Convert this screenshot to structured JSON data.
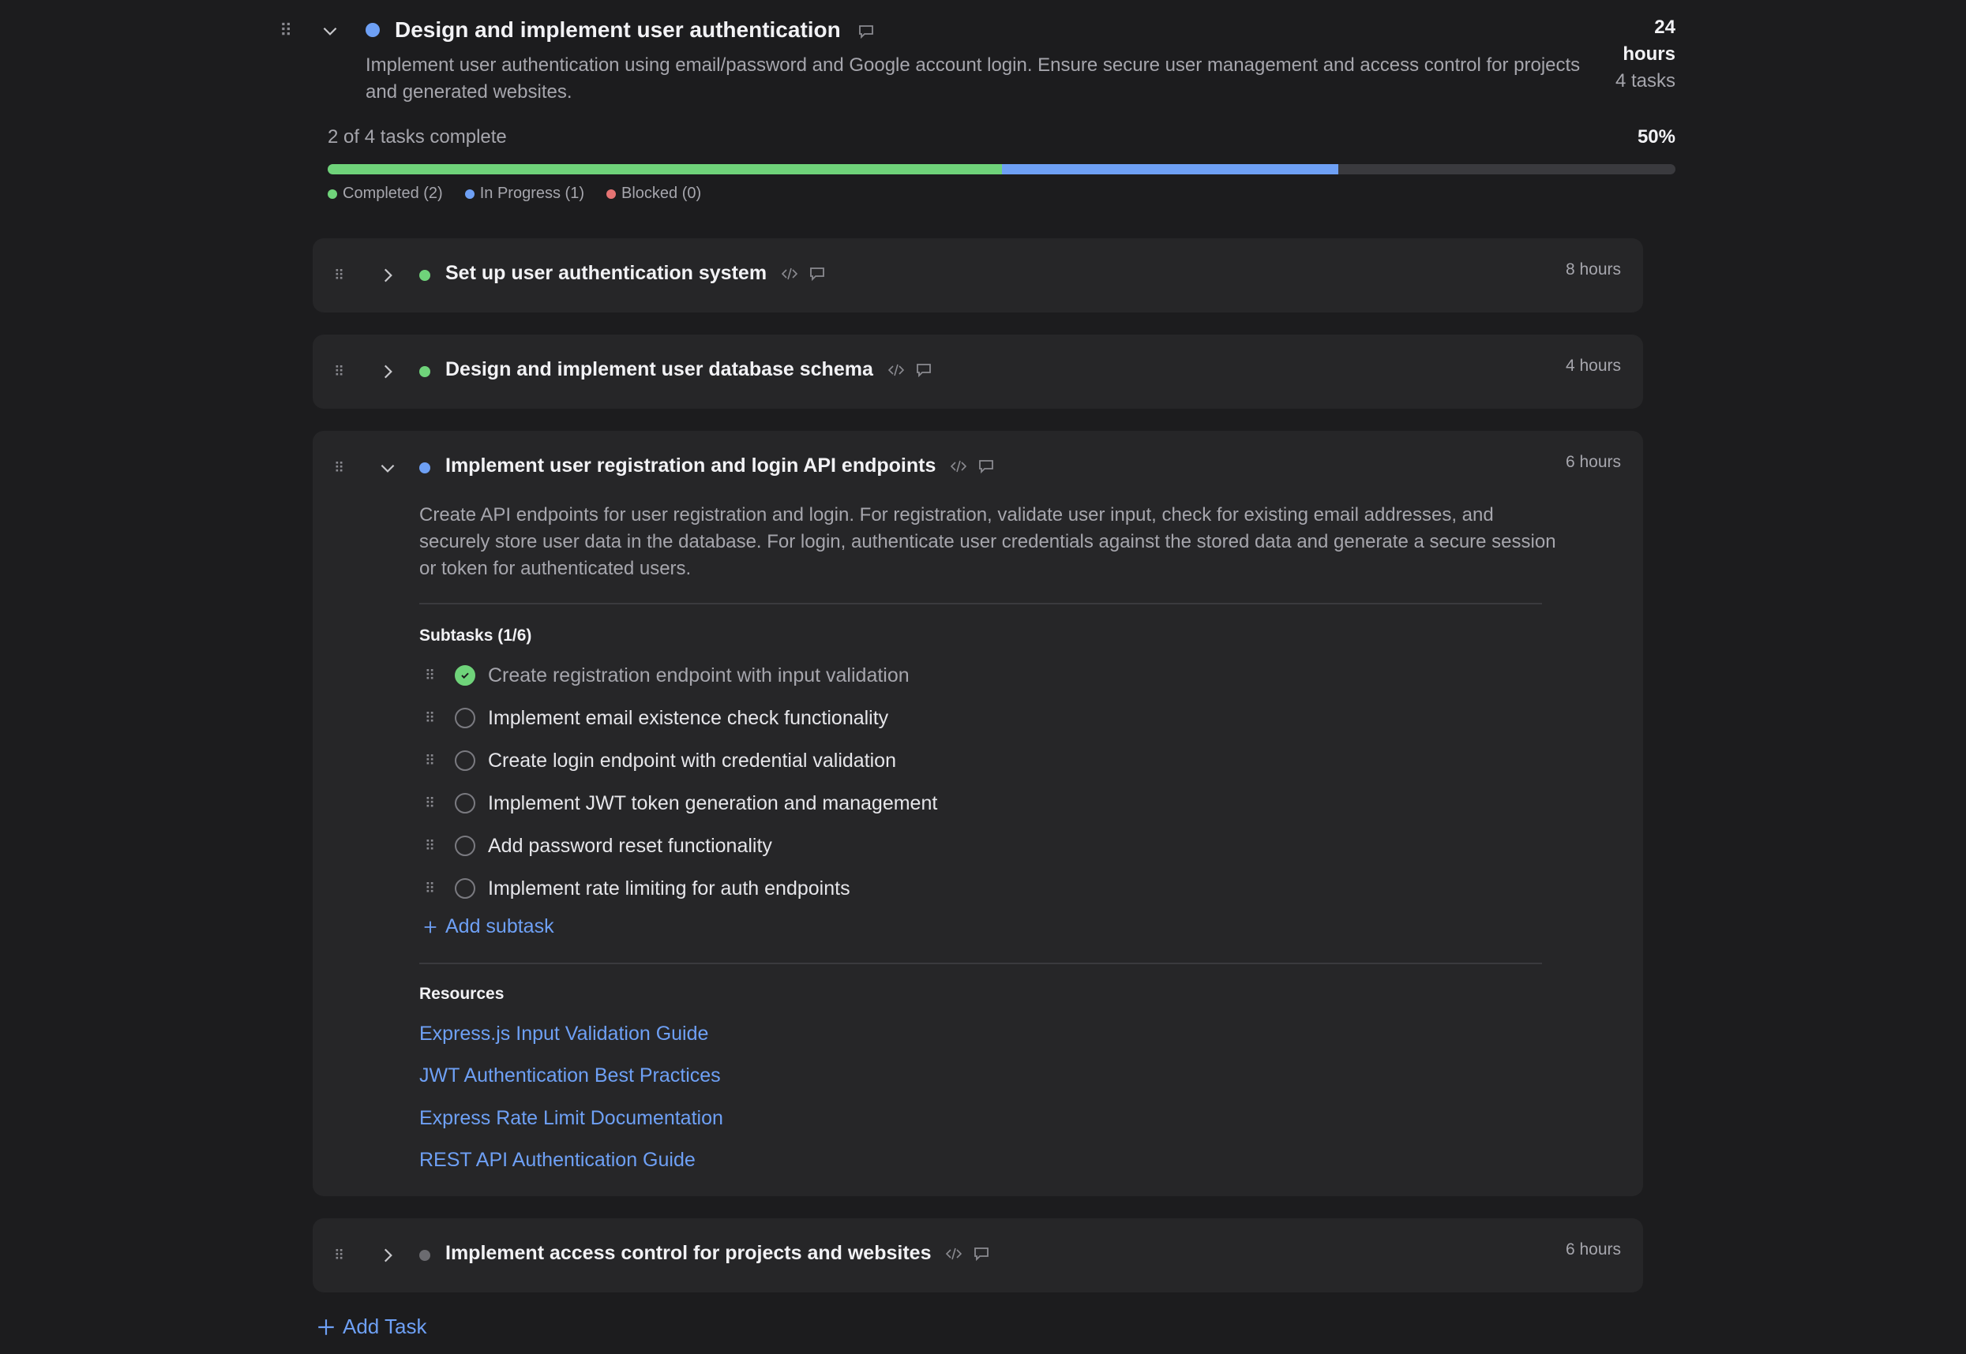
{
  "epic": {
    "title": "Design and implement user authentication",
    "description": "Implement user authentication using email/password and Google account login. Ensure secure user management and access control for projects and generated websites.",
    "hours_value": "24",
    "hours_unit": "hours",
    "task_count": "4 tasks",
    "status_color": "#6ea0f5"
  },
  "progress": {
    "summary": "2 of 4 tasks complete",
    "percent": "50%",
    "completed_fraction": 0.5,
    "in_progress_fraction": 0.25,
    "legend": [
      {
        "label": "Completed (2)",
        "color": "#6fd37a"
      },
      {
        "label": "In Progress (1)",
        "color": "#6ea0f5"
      },
      {
        "label": "Blocked (0)",
        "color": "#e57373"
      }
    ]
  },
  "tasks": [
    {
      "title": "Set up user authentication system",
      "hours": "8 hours",
      "status_color": "#6fd37a"
    },
    {
      "title": "Design and implement user database schema",
      "hours": "4 hours",
      "status_color": "#6fd37a"
    },
    {
      "title": "Implement user registration and login API endpoints",
      "hours": "6 hours",
      "status_color": "#6ea0f5",
      "description": "Create API endpoints for user registration and login. For registration, validate user input, check for existing email addresses, and securely store user data in the database. For login, authenticate user credentials against the stored data and generate a secure session or token for authenticated users.",
      "subtasks_header": "Subtasks (1/6)",
      "subtasks": [
        {
          "label": "Create registration endpoint with input validation",
          "done": true
        },
        {
          "label": "Implement email existence check functionality",
          "done": false
        },
        {
          "label": "Create login endpoint with credential validation",
          "done": false
        },
        {
          "label": "Implement JWT token generation and management",
          "done": false
        },
        {
          "label": "Add password reset functionality",
          "done": false
        },
        {
          "label": "Implement rate limiting for auth endpoints",
          "done": false
        }
      ],
      "add_subtask": "Add subtask",
      "resources_header": "Resources",
      "resources": [
        "Express.js Input Validation Guide",
        "JWT Authentication Best Practices",
        "Express Rate Limit Documentation",
        "REST API Authentication Guide"
      ]
    },
    {
      "title": "Implement access control for projects and websites",
      "hours": "6 hours",
      "status_color": "#6b6b70"
    }
  ],
  "add_task": "Add Task"
}
